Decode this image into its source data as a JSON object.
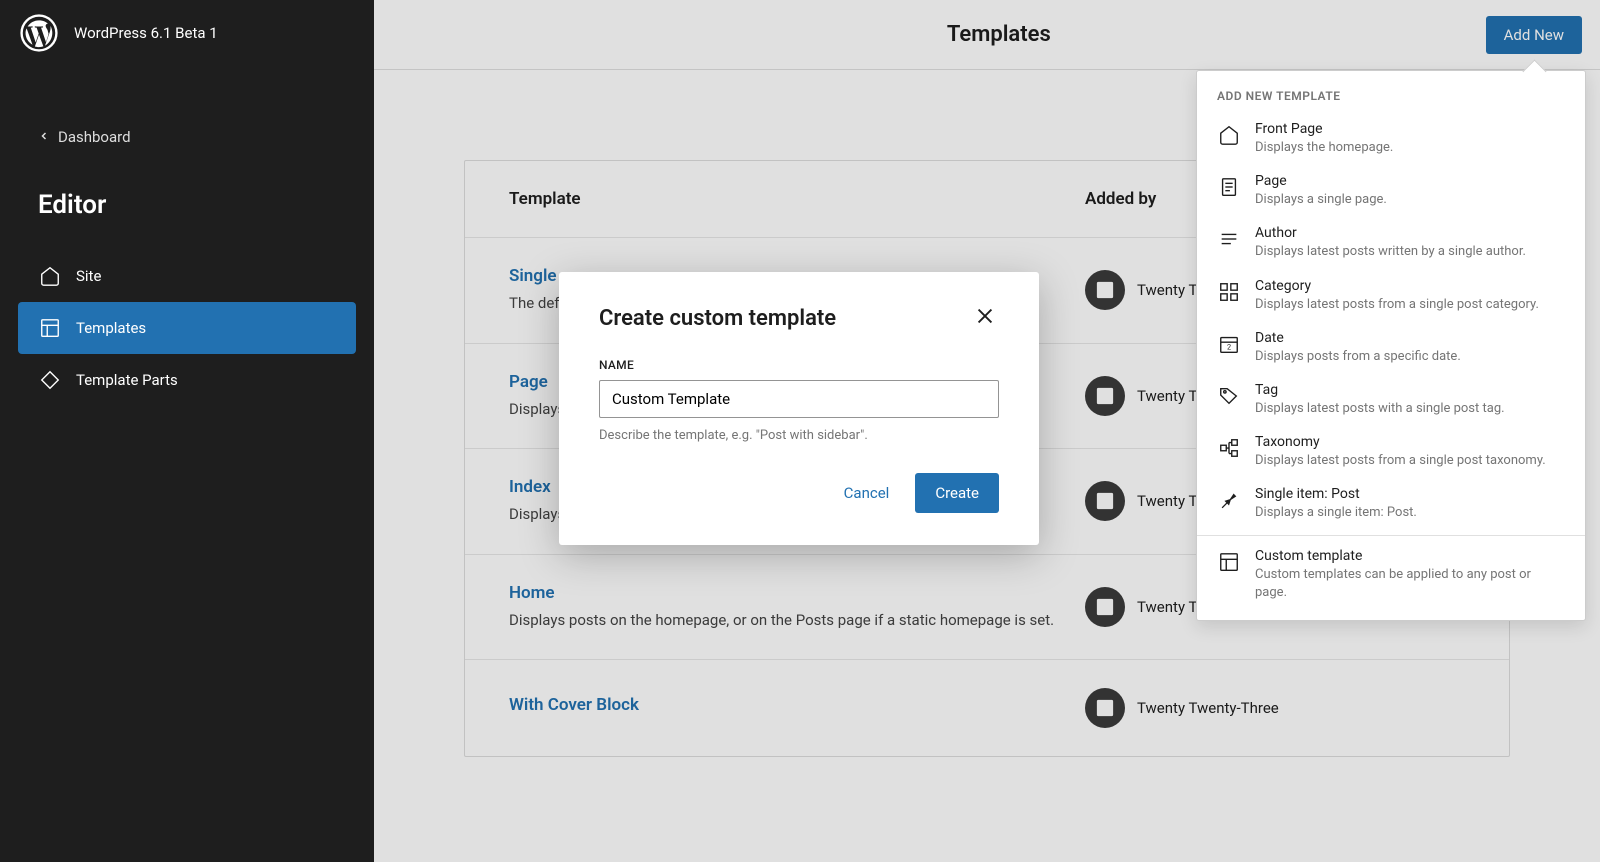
{
  "header": {
    "site_title": "WordPress 6.1 Beta 1",
    "dashboard_link": "Dashboard",
    "editor_heading": "Editor"
  },
  "sidebar": {
    "items": [
      {
        "label": "Site"
      },
      {
        "label": "Templates"
      },
      {
        "label": "Template Parts"
      }
    ]
  },
  "main": {
    "page_title": "Templates",
    "add_new": "Add New",
    "columns": {
      "template": "Template",
      "added_by": "Added by"
    },
    "rows": [
      {
        "name": "Single",
        "desc": "The default template for displaying any single post or attachment.",
        "added_by": "Twenty Twenty-Three"
      },
      {
        "name": "Page",
        "desc": "Displays a single page.",
        "added_by": "Twenty Twenty-Three"
      },
      {
        "name": "Index",
        "desc": "Displays posts.",
        "added_by": "Twenty Twenty-Three"
      },
      {
        "name": "Home",
        "desc": "Displays posts on the homepage, or on the Posts page if a static homepage is set.",
        "added_by": "Twenty Twenty-Three"
      },
      {
        "name": "With Cover Block",
        "desc": "",
        "added_by": "Twenty Twenty-Three"
      }
    ]
  },
  "popover": {
    "heading": "ADD NEW TEMPLATE",
    "items": [
      {
        "title": "Front Page",
        "desc": "Displays the homepage.",
        "icon": "home"
      },
      {
        "title": "Page",
        "desc": "Displays a single page.",
        "icon": "page"
      },
      {
        "title": "Author",
        "desc": "Displays latest posts written by a single author.",
        "icon": "author"
      },
      {
        "title": "Category",
        "desc": "Displays latest posts from a single post category.",
        "icon": "category"
      },
      {
        "title": "Date",
        "desc": "Displays posts from a specific date.",
        "icon": "date"
      },
      {
        "title": "Tag",
        "desc": "Displays latest posts with a single post tag.",
        "icon": "tag"
      },
      {
        "title": "Taxonomy",
        "desc": "Displays latest posts from a single post taxonomy.",
        "icon": "taxonomy"
      },
      {
        "title": "Single item: Post",
        "desc": "Displays a single item: Post.",
        "icon": "pin"
      }
    ],
    "custom": {
      "title": "Custom template",
      "desc": "Custom templates can be applied to any post or page.",
      "icon": "layout"
    }
  },
  "modal": {
    "title": "Create custom template",
    "name_label": "NAME",
    "name_value": "Custom Template",
    "help_text": "Describe the template, e.g. \"Post with sidebar\".",
    "cancel": "Cancel",
    "create": "Create"
  }
}
